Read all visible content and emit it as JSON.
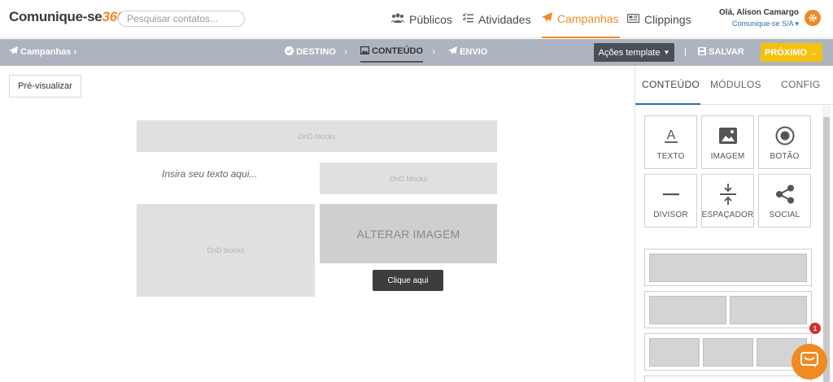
{
  "brand": {
    "name": "Comunique-se",
    "accent": "360",
    "color": "#f08a24"
  },
  "search": {
    "placeholder": "Pesquisar contatos..."
  },
  "nav": [
    {
      "label": "Públicos",
      "icon": "users-icon"
    },
    {
      "label": "Atividades",
      "icon": "checklist-icon"
    },
    {
      "label": "Campanhas",
      "icon": "paper-plane-icon",
      "active": true
    },
    {
      "label": "Clippings",
      "icon": "newspaper-icon"
    }
  ],
  "user": {
    "greeting": "Olá, Alison Camargo",
    "company": "Comunique-se S/A ▾"
  },
  "subbar": {
    "breadcrumb": "Campanhas",
    "steps": [
      {
        "label": "DESTINO",
        "icon": "check-circle-icon"
      },
      {
        "label": "CONTEÚDO",
        "icon": "image-icon",
        "active": true
      },
      {
        "label": "ENVIO",
        "icon": "paper-plane-icon"
      }
    ],
    "template_button": "Ações template",
    "save_label": "SALVAR",
    "next_label": "PRÓXIMO"
  },
  "editor": {
    "preview_button": "Pré-visualizar",
    "dnd_label": "DnD blocks",
    "text_placeholder": "Insira seu texto aqui...",
    "image_label": "ALTERAR IMAGEM",
    "cta_label": "Clique aqui"
  },
  "panel": {
    "tabs": [
      "CONTEÚDO",
      "MÓDULOS",
      "CONFIG"
    ],
    "active_tab": "CONTEÚDO",
    "tiles": [
      {
        "label": "TEXTO",
        "icon": "text-icon"
      },
      {
        "label": "IMAGEM",
        "icon": "image-icon"
      },
      {
        "label": "BOTÃO",
        "icon": "radio-button-icon"
      },
      {
        "label": "DIVISOR",
        "icon": "divider-icon"
      },
      {
        "label": "ESPAÇADOR",
        "icon": "spacer-icon"
      },
      {
        "label": "SOCIAL",
        "icon": "share-icon"
      }
    ]
  },
  "chat": {
    "badge_count": "1"
  }
}
